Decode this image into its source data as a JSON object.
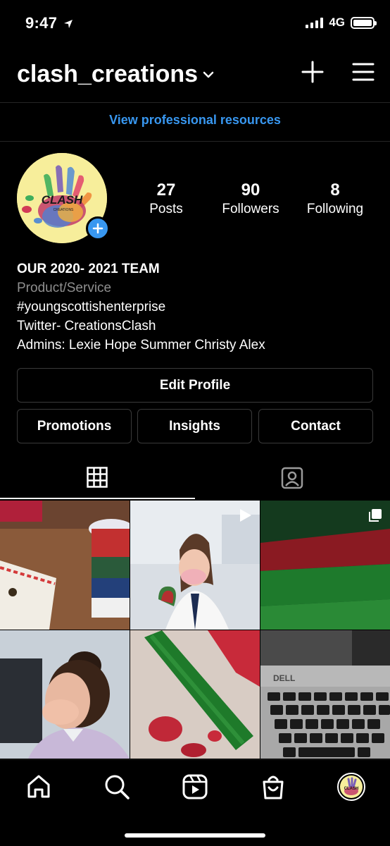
{
  "status_bar": {
    "time": "9:47",
    "network": "4G"
  },
  "header": {
    "username": "clash_creations",
    "icons": [
      "chevron-down-icon",
      "plus-icon",
      "menu-icon"
    ]
  },
  "professional_link": "View professional resources",
  "profile": {
    "avatar_text": "CLASH",
    "avatar_subtext": "CREATIONS",
    "stats": [
      {
        "value": "27",
        "label": "Posts"
      },
      {
        "value": "90",
        "label": "Followers"
      },
      {
        "value": "8",
        "label": "Following"
      }
    ],
    "bio": {
      "name": "OUR 2020- 2021 TEAM",
      "category": "Product/Service",
      "lines": [
        "#youngscottishenterprise",
        "Twitter- CreationsClash",
        "Admins: Lexie Hope Summer Christy Alex"
      ]
    }
  },
  "buttons": {
    "edit_profile": "Edit Profile",
    "promotions": "Promotions",
    "insights": "Insights",
    "contact": "Contact"
  },
  "tabs": [
    "grid-icon",
    "tagged-icon"
  ],
  "grid_posts": [
    {
      "description": "ribbon-spools-and-paper",
      "badge": null
    },
    {
      "description": "student-in-mask-with-craft",
      "badge": "reel-icon"
    },
    {
      "description": "green-glitter-strips",
      "badge": "carousel-icon"
    },
    {
      "description": "student-in-mask-profile",
      "badge": null
    },
    {
      "description": "glitter-roll-on-red",
      "badge": null
    },
    {
      "description": "dell-laptop-keyboard",
      "badge": null
    }
  ],
  "bottom_nav": [
    "home-icon",
    "search-icon",
    "reels-icon",
    "shop-icon",
    "profile-avatar"
  ],
  "colors": {
    "background": "#000000",
    "link_blue": "#3897f0",
    "secondary_text": "#8e8e8e",
    "border": "#3a3a3a",
    "avatar_yellow": "#f7ee9b"
  }
}
